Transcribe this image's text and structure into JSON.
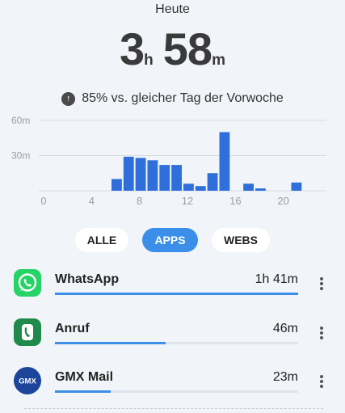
{
  "header": {
    "title": "Heute"
  },
  "total": {
    "hours": "3",
    "hours_unit": "h",
    "minutes": "58",
    "minutes_unit": "m"
  },
  "comparison": {
    "text": "85% vs. gleicher Tag der Vorwoche",
    "icon": "arrow-up-icon"
  },
  "chart_data": {
    "type": "bar",
    "x": [
      0,
      1,
      2,
      3,
      4,
      5,
      6,
      7,
      8,
      9,
      10,
      11,
      12,
      13,
      14,
      15,
      16,
      17,
      18,
      19,
      20,
      21,
      22,
      23
    ],
    "values": [
      0,
      0,
      0,
      0,
      0,
      0,
      10,
      29,
      28,
      26,
      22,
      22,
      6,
      4,
      15,
      50,
      0,
      6,
      2,
      0,
      0,
      7,
      0,
      0
    ],
    "ylim": [
      0,
      60
    ],
    "y_ticks": [
      "60m",
      "30m"
    ],
    "x_ticks": [
      "0",
      "4",
      "8",
      "12",
      "16",
      "20"
    ],
    "grid": true,
    "bar_color": "#2f6fdb"
  },
  "tabs": [
    {
      "label": "ALLE",
      "active": false
    },
    {
      "label": "APPS",
      "active": true
    },
    {
      "label": "WEBS",
      "active": false
    }
  ],
  "apps": [
    {
      "name": "WhatsApp",
      "time": "1h 41m",
      "share": 1.0,
      "icon": "whatsapp-icon",
      "color": "#25d366"
    },
    {
      "name": "Anruf",
      "time": "46m",
      "share": 0.455,
      "icon": "phone-icon",
      "color": "#1f8a4c"
    },
    {
      "name": "GMX Mail",
      "time": "23m",
      "share": 0.23,
      "icon": "gmx-icon",
      "color": "#1c449b",
      "icon_text": "GMX"
    }
  ],
  "colors": {
    "accent": "#3b8fe8",
    "background": "#f1f4f8"
  }
}
